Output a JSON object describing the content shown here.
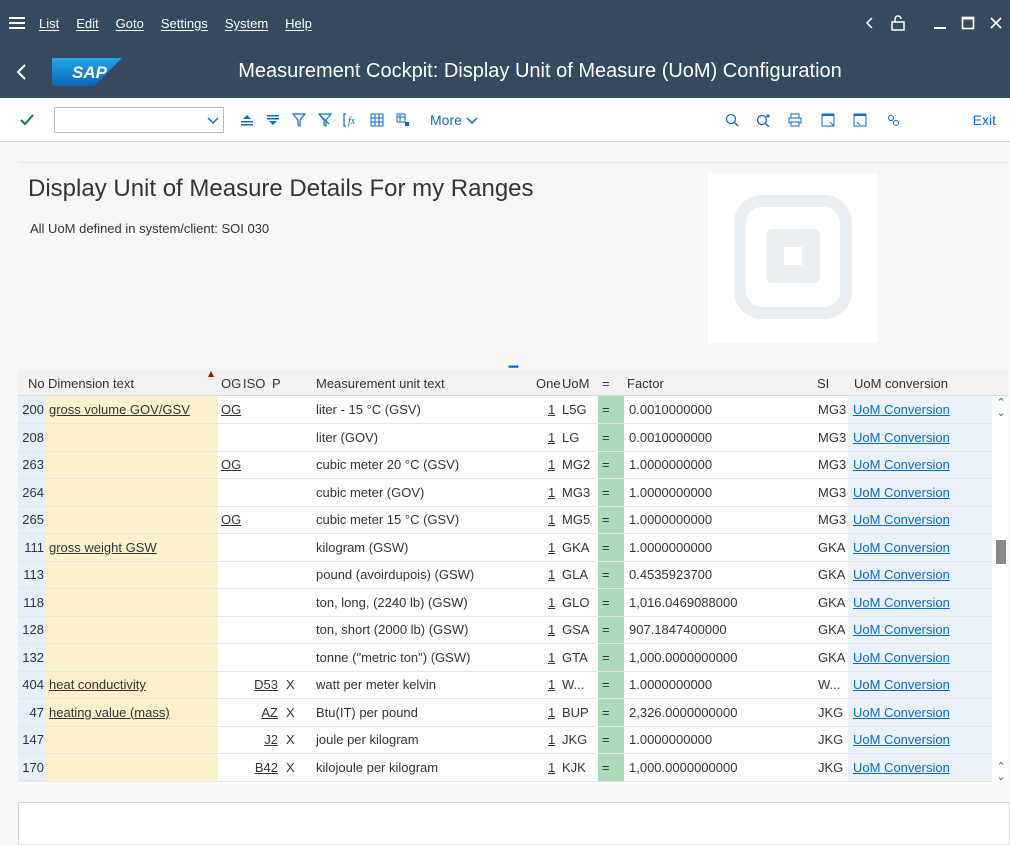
{
  "menubar": {
    "items": [
      "List",
      "Edit",
      "Goto",
      "Settings",
      "System",
      "Help"
    ]
  },
  "titlebar": {
    "logo_text": "SAP",
    "title": "Measurement Cockpit: Display Unit of Measure (UoM) Configuration"
  },
  "toolbar": {
    "more_label": "More",
    "exit_label": "Exit",
    "combo_value": ""
  },
  "header": {
    "heading": "Display Unit of Measure Details For my Ranges",
    "subtitle": "All UoM defined in system/client: SOI 030"
  },
  "grid": {
    "columns": {
      "no": "No",
      "dimension": "Dimension text",
      "og": "OG",
      "iso": "ISO",
      "p": "P",
      "munit": "Measurement unit text",
      "one": "One",
      "uom": "UoM",
      "eq": "=",
      "factor": "Factor",
      "si": "SI",
      "conv": "UoM conversion"
    },
    "rows": [
      {
        "no": "200",
        "dim": "gross volume GOV/GSV",
        "og": "OG",
        "iso": "",
        "p": "",
        "munit": "liter - 15 °C (GSV)",
        "one": "1",
        "uom": "L5G",
        "eq": "=",
        "factor": "0.0010000000",
        "si": "MG3",
        "conv": "UoM Conversion"
      },
      {
        "no": "208",
        "dim": "",
        "og": "",
        "iso": "",
        "p": "",
        "munit": "liter (GOV)",
        "one": "1",
        "uom": "LG",
        "eq": "=",
        "factor": "0.0010000000",
        "si": "MG3",
        "conv": "UoM Conversion"
      },
      {
        "no": "263",
        "dim": "",
        "og": "OG",
        "iso": "",
        "p": "",
        "munit": "cubic meter 20 °C (GSV)",
        "one": "1",
        "uom": "MG2",
        "eq": "=",
        "factor": "1.0000000000",
        "si": "MG3",
        "conv": "UoM Conversion"
      },
      {
        "no": "264",
        "dim": "",
        "og": "",
        "iso": "",
        "p": "",
        "munit": "cubic meter (GOV)",
        "one": "1",
        "uom": "MG3",
        "eq": "=",
        "factor": "1.0000000000",
        "si": "MG3",
        "conv": "UoM Conversion"
      },
      {
        "no": "265",
        "dim": "",
        "og": "OG",
        "iso": "",
        "p": "",
        "munit": "cubic meter 15 °C (GSV)",
        "one": "1",
        "uom": "MG5",
        "eq": "=",
        "factor": "1.0000000000",
        "si": "MG3",
        "conv": "UoM Conversion"
      },
      {
        "no": "111",
        "dim": "gross weight GSW",
        "og": "",
        "iso": "",
        "p": "",
        "munit": "kilogram (GSW)",
        "one": "1",
        "uom": "GKA",
        "eq": "=",
        "factor": "1.0000000000",
        "si": "GKA",
        "conv": "UoM Conversion"
      },
      {
        "no": "113",
        "dim": "",
        "og": "",
        "iso": "",
        "p": "",
        "munit": "pound (avoirdupois) (GSW)",
        "one": "1",
        "uom": "GLA",
        "eq": "=",
        "factor": "0.4535923700",
        "si": "GKA",
        "conv": "UoM Conversion"
      },
      {
        "no": "118",
        "dim": "",
        "og": "",
        "iso": "",
        "p": "",
        "munit": "ton, long, (2240 lb) (GSW)",
        "one": "1",
        "uom": "GLO",
        "eq": "=",
        "factor": "1,016.0469088000",
        "si": "GKA",
        "conv": "UoM Conversion"
      },
      {
        "no": "128",
        "dim": "",
        "og": "",
        "iso": "",
        "p": "",
        "munit": "ton, short (2000 lb) (GSW)",
        "one": "1",
        "uom": "GSA",
        "eq": "=",
        "factor": "907.1847400000",
        "si": "GKA",
        "conv": "UoM Conversion"
      },
      {
        "no": "132",
        "dim": "",
        "og": "",
        "iso": "",
        "p": "",
        "munit": "tonne (\"metric ton\") (GSW)",
        "one": "1",
        "uom": "GTA",
        "eq": "=",
        "factor": "1,000.0000000000",
        "si": "GKA",
        "conv": "UoM Conversion"
      },
      {
        "no": "404",
        "dim": "heat conductivity",
        "og": "",
        "iso": "D53",
        "p": "X",
        "munit": "watt per meter kelvin",
        "one": "1",
        "uom": "W...",
        "eq": "=",
        "factor": "1.0000000000",
        "si": "W...",
        "conv": "UoM Conversion"
      },
      {
        "no": "47",
        "dim": "heating value (mass)",
        "og": "",
        "iso": "AZ",
        "p": "X",
        "munit": "Btu(IT) per pound",
        "one": "1",
        "uom": "BUP",
        "eq": "=",
        "factor": "2,326.0000000000",
        "si": "JKG",
        "conv": "UoM Conversion"
      },
      {
        "no": "147",
        "dim": "",
        "og": "",
        "iso": "J2",
        "p": "X",
        "munit": "joule per kilogram",
        "one": "1",
        "uom": "JKG",
        "eq": "=",
        "factor": "1.0000000000",
        "si": "JKG",
        "conv": "UoM Conversion"
      },
      {
        "no": "170",
        "dim": "",
        "og": "",
        "iso": "B42",
        "p": "X",
        "munit": "kilojoule per kilogram",
        "one": "1",
        "uom": "KJK",
        "eq": "=",
        "factor": "1,000.0000000000",
        "si": "JKG",
        "conv": "UoM Conversion"
      }
    ]
  },
  "colors": {
    "shell": "#354a5f",
    "accent": "#0a6ed1",
    "key_column": "#faf0cc",
    "eq_column": "#abdbbb"
  }
}
